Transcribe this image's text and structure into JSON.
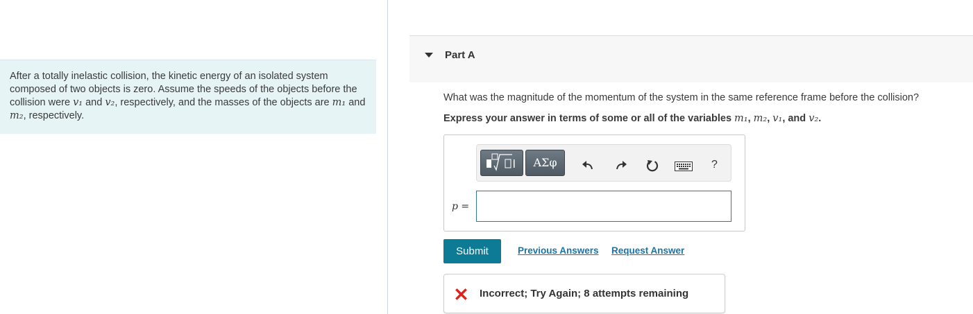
{
  "problem": {
    "text_1": "After a totally inelastic collision, the kinetic energy of an isolated system composed of two objects is zero. Assume the speeds of the objects before the collision were ",
    "v1": "v₁",
    "text_2": " and ",
    "v2": "v₂",
    "text_3": ", respectively, and the masses of the objects are ",
    "m1": "m₁",
    "text_4": " and ",
    "m2": "m₂",
    "text_5": ", respectively."
  },
  "part": {
    "title": "Part A"
  },
  "question": {
    "text": "What was the magnitude of the momentum of the system in the same reference frame before the collision?",
    "instruction_prefix": "Express your answer in terms of some or all of the variables ",
    "var_m1": "m₁",
    "sep_1": ", ",
    "var_m2": "m₂",
    "sep_2": ", ",
    "var_v1": "v₁",
    "sep_3": ", and ",
    "var_v2": "v₂",
    "instruction_suffix": "."
  },
  "toolbar": {
    "greek_label": "ΑΣφ",
    "help_label": "?"
  },
  "answer": {
    "variable_label": "p =",
    "value": ""
  },
  "actions": {
    "submit_label": "Submit",
    "previous_answers_label": "Previous Answers",
    "request_answer_label": "Request Answer"
  },
  "feedback": {
    "text": "Incorrect; Try Again; 8 attempts remaining"
  },
  "colors": {
    "problem_background": "#e6f4f6",
    "submit_button": "#0d7a96",
    "link": "#1a73a8",
    "error_icon": "#d9231d"
  }
}
